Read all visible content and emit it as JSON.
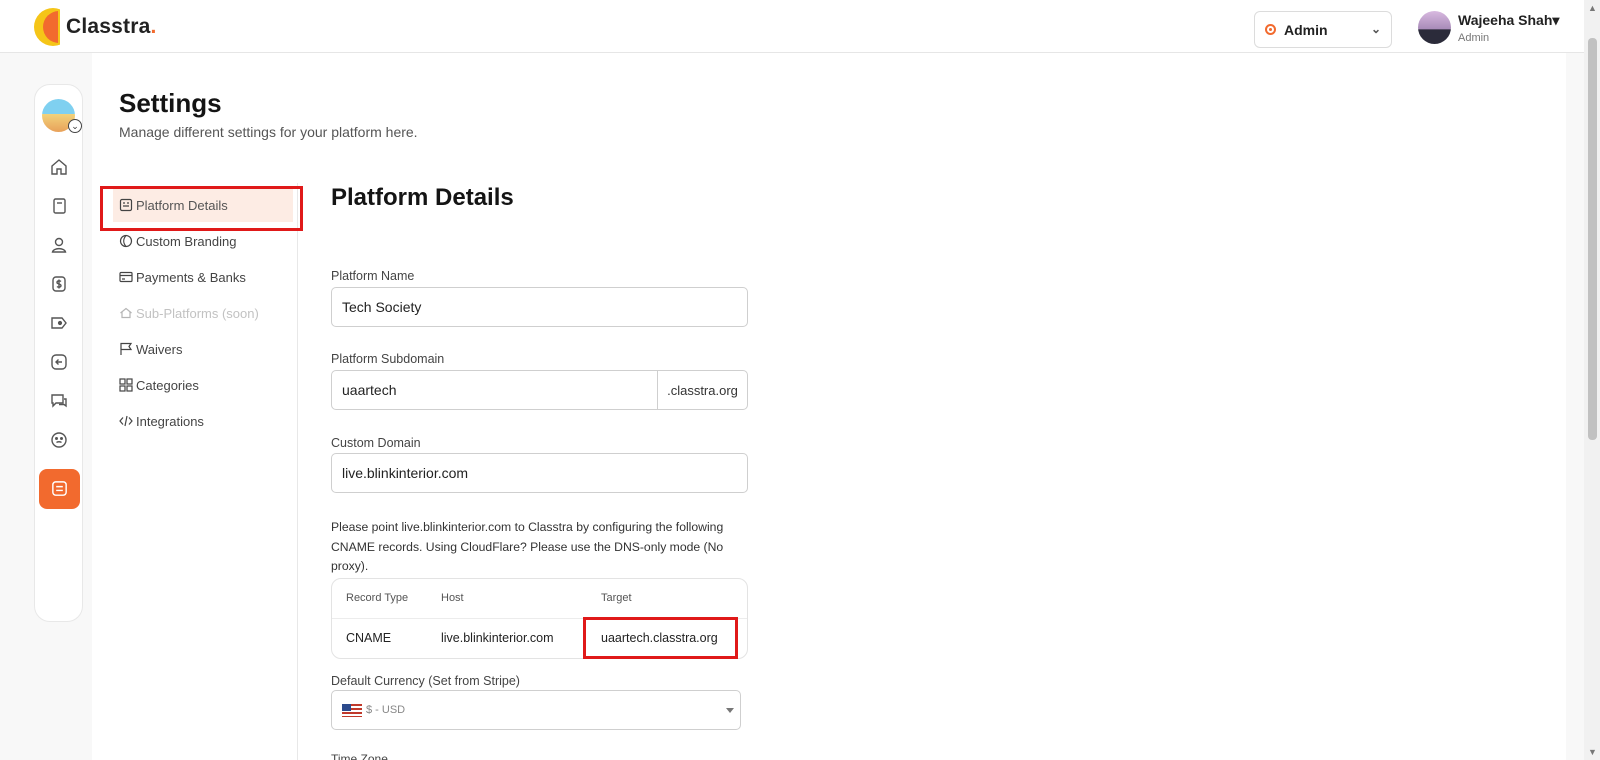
{
  "app": {
    "brand": "Classtra",
    "brand_dot": "."
  },
  "header": {
    "role_label": "Admin",
    "user_name": "Wajeeha Shah",
    "user_role": "Admin",
    "user_caret": "▾",
    "role_chevron": "⌄"
  },
  "page": {
    "title": "Settings",
    "subtitle": "Manage different settings for your platform here."
  },
  "settings_nav": [
    {
      "label": "Platform Details",
      "icon": "document-icon"
    },
    {
      "label": "Custom Branding",
      "icon": "palette-icon"
    },
    {
      "label": "Payments & Banks",
      "icon": "card-icon"
    },
    {
      "label": "Sub-Platforms (soon)",
      "icon": "home-icon"
    },
    {
      "label": "Waivers",
      "icon": "flag-icon"
    },
    {
      "label": "Categories",
      "icon": "grid-icon"
    },
    {
      "label": "Integrations",
      "icon": "code-icon"
    }
  ],
  "form": {
    "section_title": "Platform Details",
    "platform_name_label": "Platform Name",
    "platform_name_value": "Tech Society",
    "subdomain_label": "Platform Subdomain",
    "subdomain_value": "uaartech",
    "subdomain_suffix": ".classtra.org",
    "custom_domain_label": "Custom Domain",
    "custom_domain_value": "live.blinkinterior.com",
    "note": "Please point live.blinkinterior.com to Classtra by configuring the following CNAME records. Using CloudFlare? Please use the DNS-only mode (No proxy).",
    "dns": {
      "headers": [
        "Record Type",
        "Host",
        "Target"
      ],
      "row": [
        "CNAME",
        "live.blinkinterior.com",
        "uaartech.classtra.org"
      ]
    },
    "currency_label": "Default Currency (Set from Stripe)",
    "currency_value": "$ - USD",
    "next_label": "Time Zone"
  },
  "colors": {
    "accent": "#f26a2e",
    "highlight": "#e01919",
    "active_nav_bg": "#fdece4"
  }
}
